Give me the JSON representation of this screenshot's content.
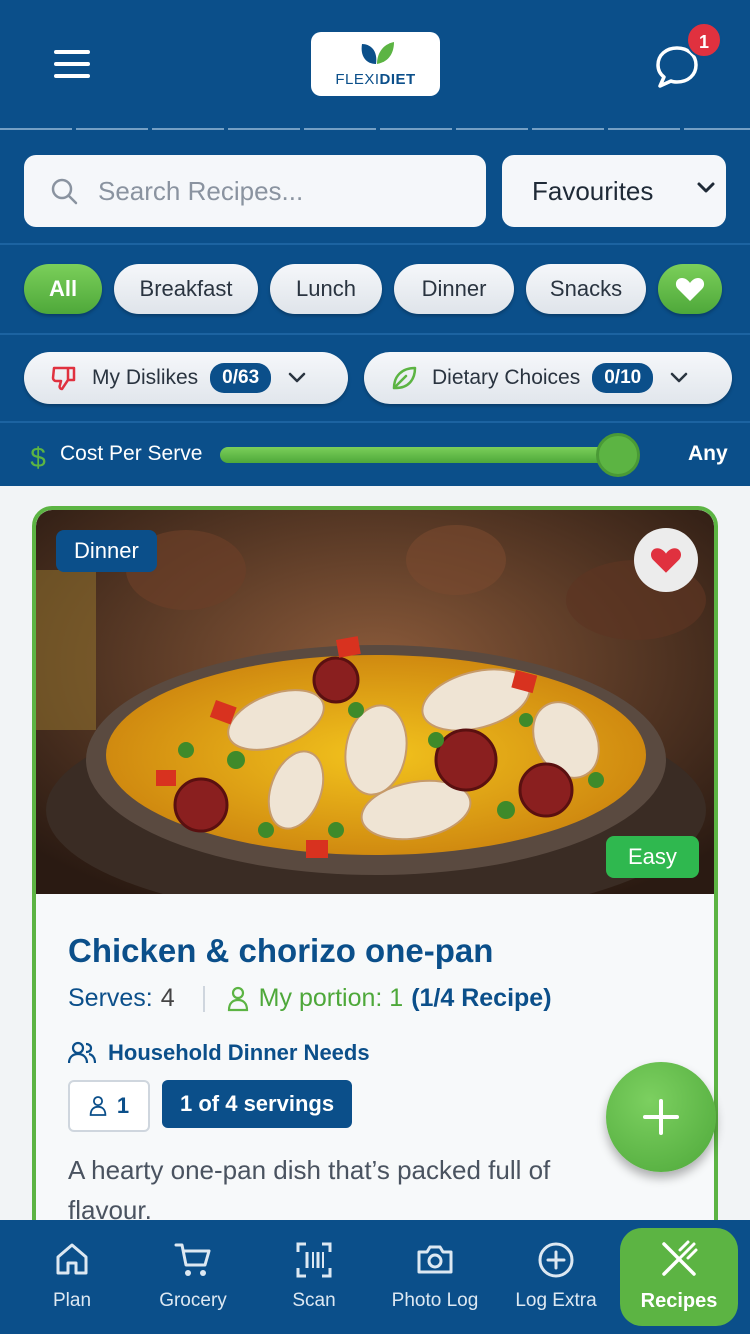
{
  "header": {
    "logo_text_light": "FLEXI",
    "logo_text_bold": "DIET",
    "notification_count": "1"
  },
  "search": {
    "placeholder": "Search Recipes...",
    "filter_selected": "Favourites"
  },
  "categories": [
    "All",
    "Breakfast",
    "Lunch",
    "Dinner",
    "Snacks"
  ],
  "filters": {
    "dislikes_label": "My Dislikes",
    "dislikes_count": "0/63",
    "dietary_label": "Dietary Choices",
    "dietary_count": "0/10"
  },
  "cost": {
    "label": "Cost Per Serve",
    "value_label": "Any",
    "slider_level": 1.0
  },
  "recipe": {
    "category_tag": "Dinner",
    "difficulty": "Easy",
    "title": "Chicken & chorizo one-pan",
    "serves_label": "Serves:",
    "serves_value": "4",
    "portion_label": "My portion: 1",
    "portion_extra": "(1/4 Recipe)",
    "household_label": "Household Dinner Needs",
    "household_people": "1",
    "servings_label": "1 of 4 servings",
    "description": "A hearty one-pan dish that’s packed full of flavour."
  },
  "nav": [
    {
      "label": "Plan"
    },
    {
      "label": "Grocery"
    },
    {
      "label": "Scan"
    },
    {
      "label": "Photo Log"
    },
    {
      "label": "Log Extra"
    },
    {
      "label": "Recipes"
    }
  ],
  "colors": {
    "brand_blue": "#0b4f8a",
    "accent_green": "#5cb443",
    "badge_red": "#e0313f"
  }
}
